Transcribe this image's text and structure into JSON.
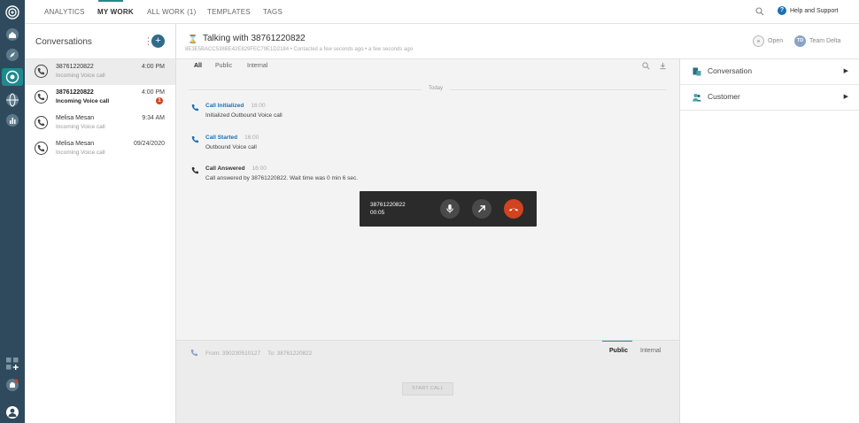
{
  "nav": {
    "tabs": [
      "ANALYTICS",
      "MY WORK",
      "ALL WORK (1)",
      "TEMPLATES",
      "TAGS"
    ],
    "help_label": "Help and Support"
  },
  "conversations": {
    "title": "Conversations",
    "items": [
      {
        "name": "38761220822",
        "sub": "Incoming Voice call",
        "time": "4:00 PM"
      },
      {
        "name": "38761220822",
        "sub": "Incoming Voice call",
        "time": "4:00 PM",
        "badge": "1"
      },
      {
        "name": "Melisa Mesan",
        "sub": "Incoming Voice call",
        "time": "9:34 AM"
      },
      {
        "name": "Melisa Mesan",
        "sub": "Incoming Voice call",
        "time": "09/24/2020"
      }
    ]
  },
  "header": {
    "title": "Talking with 38761220822",
    "meta": "8E3E5BACC538BE42E829FEC79E1D2184 • Contacted a few seconds ago • a few seconds ago",
    "status": "Open",
    "team_initials": "TD",
    "team": "Team Delta"
  },
  "timeline": {
    "tabs": [
      "All",
      "Public",
      "Internal"
    ],
    "day": "Today",
    "events": [
      {
        "title": "Call Initialized",
        "time": "16:00",
        "desc": "Initialized Outbound Voice call"
      },
      {
        "title": "Call Started",
        "time": "16:00",
        "desc": "Outbound Voice call"
      },
      {
        "title": "Call Answered",
        "time": "16:00",
        "desc": "Call answered by 38761220822. Wait time was 0 min 6 sec."
      }
    ]
  },
  "call": {
    "number": "38761220822",
    "duration": "00:05"
  },
  "composer": {
    "from": "From: 390230510127",
    "to": "To: 38761220822",
    "tabs": [
      "Public",
      "Internal"
    ],
    "start_call": "START CALL"
  },
  "right_panel": {
    "items": [
      "Conversation",
      "Customer"
    ]
  },
  "colors": {
    "rail": "#2f4a5c",
    "accent": "#1f8a8e",
    "link": "#1b6fb5",
    "hangup": "#d2431f"
  }
}
